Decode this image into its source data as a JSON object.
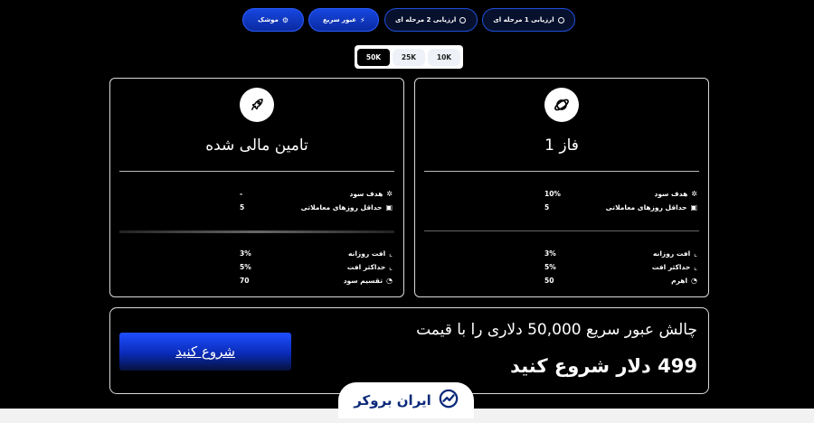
{
  "top_tabs": [
    {
      "label": "ارزیابی 1 مرحله ای",
      "icon": "circle-icon"
    },
    {
      "label": "ارزیابی 2 مرحله ای",
      "icon": "circle-icon"
    },
    {
      "label": "عبور سریع",
      "icon": "lightning-icon"
    },
    {
      "label": "موشک",
      "icon": "rocket-gear-icon"
    }
  ],
  "size_options": [
    "50K",
    "25K",
    "10K"
  ],
  "active_size": "50K",
  "cards": {
    "left": {
      "title": "تامین مالی شده",
      "icon": "rocket-icon",
      "rows_top": [
        {
          "label": "هدف سود",
          "value": "-"
        },
        {
          "label": "حداقل روزهای معاملاتی",
          "value": "5"
        }
      ],
      "rows_bottom": [
        {
          "label": "افت روزانه",
          "value": "3%"
        },
        {
          "label": "حداکثر افت",
          "value": "5%"
        },
        {
          "label": "تقسیم سود",
          "value": "70"
        }
      ]
    },
    "right": {
      "title": "فاز 1",
      "icon": "orbit-icon",
      "rows_top": [
        {
          "label": "هدف سود",
          "value": "10%"
        },
        {
          "label": "حداقل روزهای معاملاتی",
          "value": "5"
        }
      ],
      "rows_bottom": [
        {
          "label": "افت روزانه",
          "value": "3%"
        },
        {
          "label": "حداکثر افت",
          "value": "5%"
        },
        {
          "label": "اهرم",
          "value": "50"
        }
      ]
    }
  },
  "cta": {
    "line1": "چالش عبور سریع 50,000 دلاری را با قیمت",
    "line2": "499 دلار شروع کنید",
    "button_label": "شروع کنید"
  },
  "logo": {
    "text": "ایران بروکر"
  },
  "colors": {
    "accent": "#1747e0",
    "background": "#000000"
  }
}
